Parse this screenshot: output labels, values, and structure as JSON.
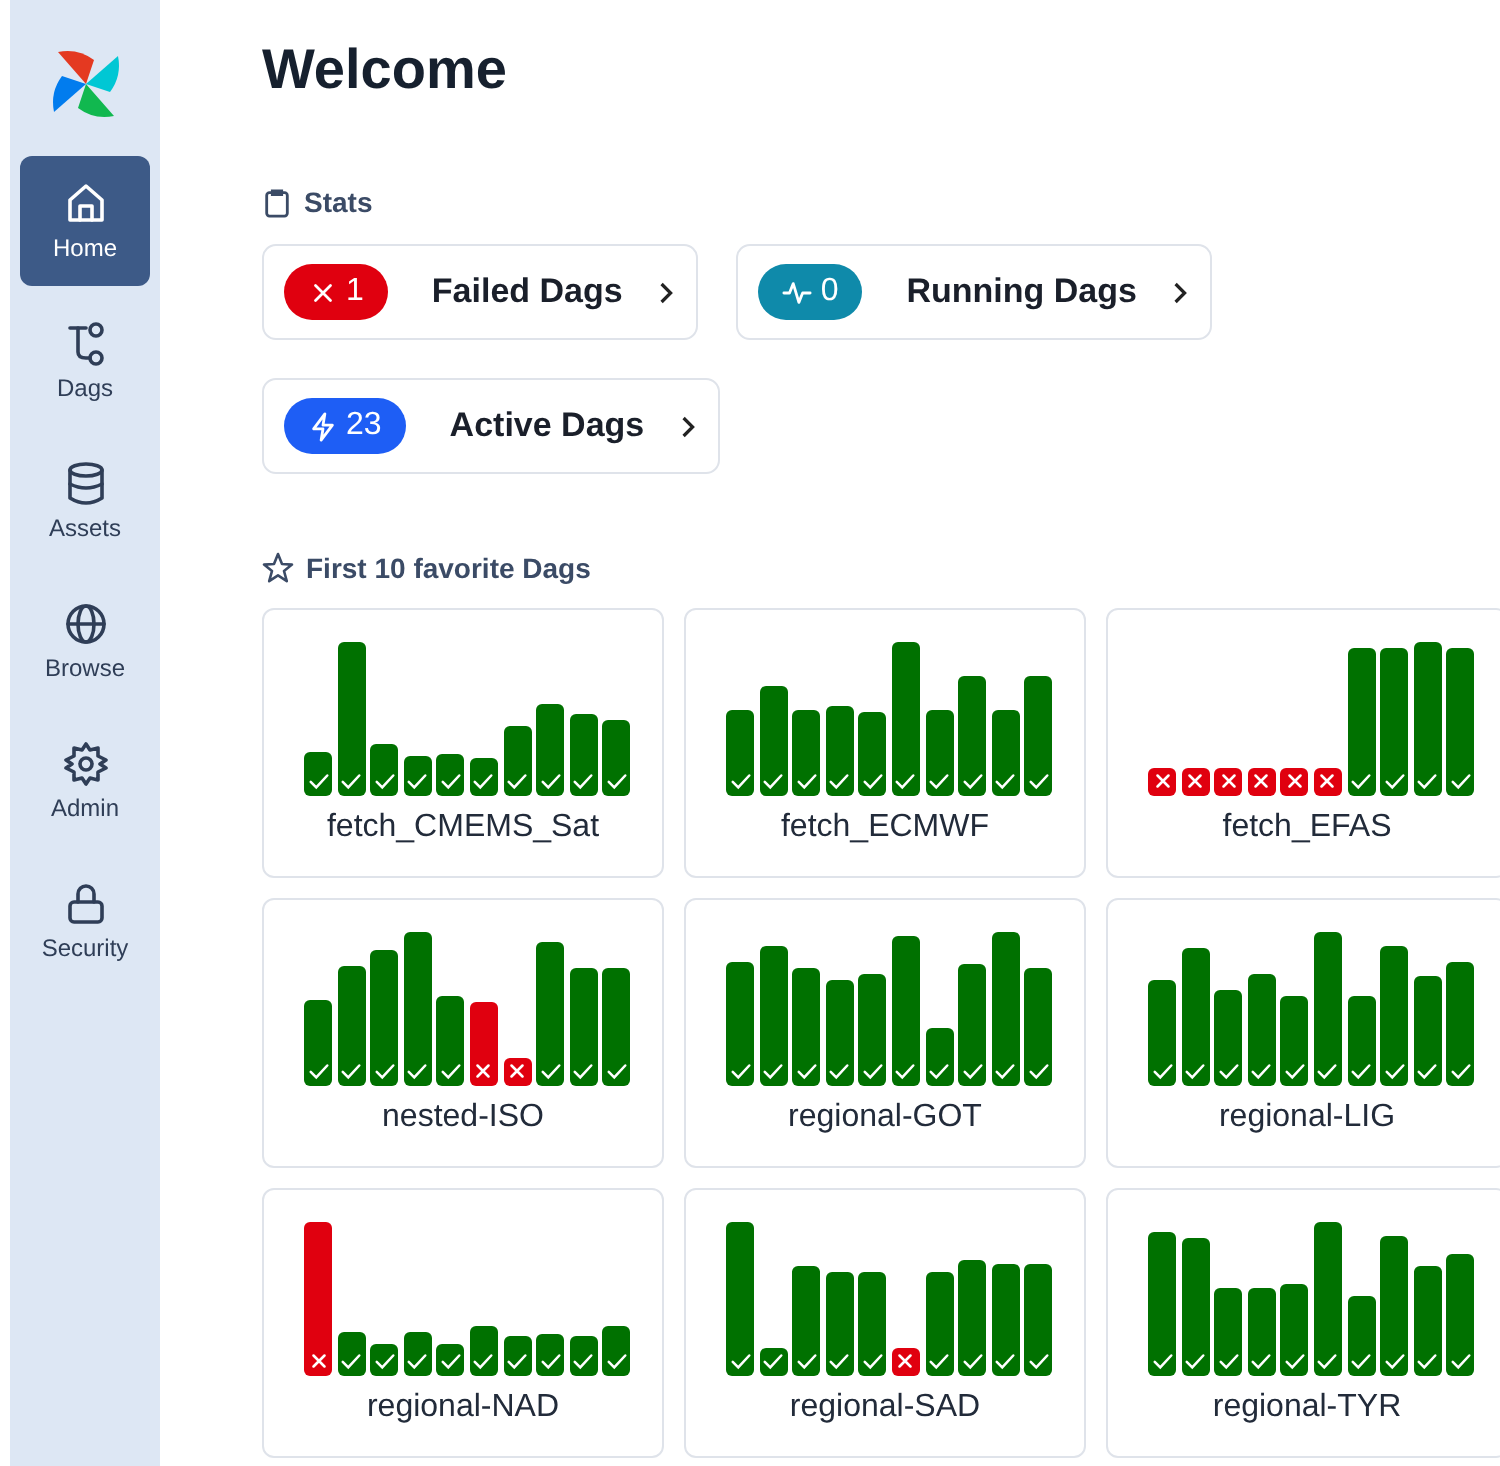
{
  "sidebar": {
    "items": [
      {
        "label": "Home",
        "selected": true
      },
      {
        "label": "Dags",
        "selected": false
      },
      {
        "label": "Assets",
        "selected": false
      },
      {
        "label": "Browse",
        "selected": false
      },
      {
        "label": "Admin",
        "selected": false
      },
      {
        "label": "Security",
        "selected": false
      }
    ]
  },
  "title": "Welcome",
  "stats": {
    "heading": "Stats",
    "cards": [
      {
        "kind": "failed",
        "count": "1",
        "label": "Failed Dags"
      },
      {
        "kind": "running",
        "count": "0",
        "label": "Running Dags"
      },
      {
        "kind": "active",
        "count": "23",
        "label": "Active Dags"
      }
    ]
  },
  "favorites": {
    "heading": "First 10 favorite Dags",
    "dags": [
      {
        "name": "fetch_CMEMS_Sat",
        "runs": [
          {
            "failed": false
          },
          {
            "failed": false
          },
          {
            "failed": false
          },
          {
            "failed": false
          },
          {
            "failed": false
          },
          {
            "failed": false
          },
          {
            "failed": false
          },
          {
            "failed": false
          },
          {
            "failed": false
          },
          {
            "failed": false
          }
        ]
      },
      {
        "name": "fetch_ECMWF",
        "runs": [
          {
            "failed": false
          },
          {
            "failed": false
          },
          {
            "failed": false
          },
          {
            "failed": false
          },
          {
            "failed": false
          },
          {
            "failed": false
          },
          {
            "failed": false
          },
          {
            "failed": false
          },
          {
            "failed": false
          },
          {
            "failed": false
          }
        ]
      },
      {
        "name": "fetch_EFAS",
        "runs": [
          {
            "failed": true
          },
          {
            "failed": true
          },
          {
            "failed": true
          },
          {
            "failed": true
          },
          {
            "failed": true
          },
          {
            "failed": true
          },
          {
            "failed": false
          },
          {
            "failed": false
          },
          {
            "failed": false
          },
          {
            "failed": false
          }
        ]
      },
      {
        "name": "nested-ISO",
        "runs": [
          {
            "failed": false
          },
          {
            "failed": false
          },
          {
            "failed": false
          },
          {
            "failed": false
          },
          {
            "failed": false
          },
          {
            "failed": true
          },
          {
            "failed": true
          },
          {
            "failed": false
          },
          {
            "failed": false
          },
          {
            "failed": false
          }
        ]
      },
      {
        "name": "regional-GOT",
        "runs": [
          {
            "failed": false
          },
          {
            "failed": false
          },
          {
            "failed": false
          },
          {
            "failed": false
          },
          {
            "failed": false
          },
          {
            "failed": false
          },
          {
            "failed": false
          },
          {
            "failed": false
          },
          {
            "failed": false
          },
          {
            "failed": false
          }
        ]
      },
      {
        "name": "regional-LIG",
        "runs": [
          {
            "failed": false
          },
          {
            "failed": false
          },
          {
            "failed": false
          },
          {
            "failed": false
          },
          {
            "failed": false
          },
          {
            "failed": false
          },
          {
            "failed": false
          },
          {
            "failed": false
          },
          {
            "failed": false
          },
          {
            "failed": false
          }
        ]
      },
      {
        "name": "regional-NAD",
        "runs": [
          {
            "failed": true
          },
          {
            "failed": false
          },
          {
            "failed": false
          },
          {
            "failed": false
          },
          {
            "failed": false
          },
          {
            "failed": false
          },
          {
            "failed": false
          },
          {
            "failed": false
          },
          {
            "failed": false
          },
          {
            "failed": false
          }
        ]
      },
      {
        "name": "regional-SAD",
        "runs": [
          {
            "failed": false
          },
          {
            "failed": false
          },
          {
            "failed": false
          },
          {
            "failed": false
          },
          {
            "failed": false
          },
          {
            "failed": true
          },
          {
            "failed": false
          },
          {
            "failed": false
          },
          {
            "failed": false
          },
          {
            "failed": false
          }
        ]
      },
      {
        "name": "regional-TYR",
        "runs": [
          {
            "failed": false
          },
          {
            "failed": false
          },
          {
            "failed": false
          },
          {
            "failed": false
          },
          {
            "failed": false
          },
          {
            "failed": false
          },
          {
            "failed": false
          },
          {
            "failed": false
          },
          {
            "failed": false
          },
          {
            "failed": false
          }
        ]
      }
    ]
  }
}
